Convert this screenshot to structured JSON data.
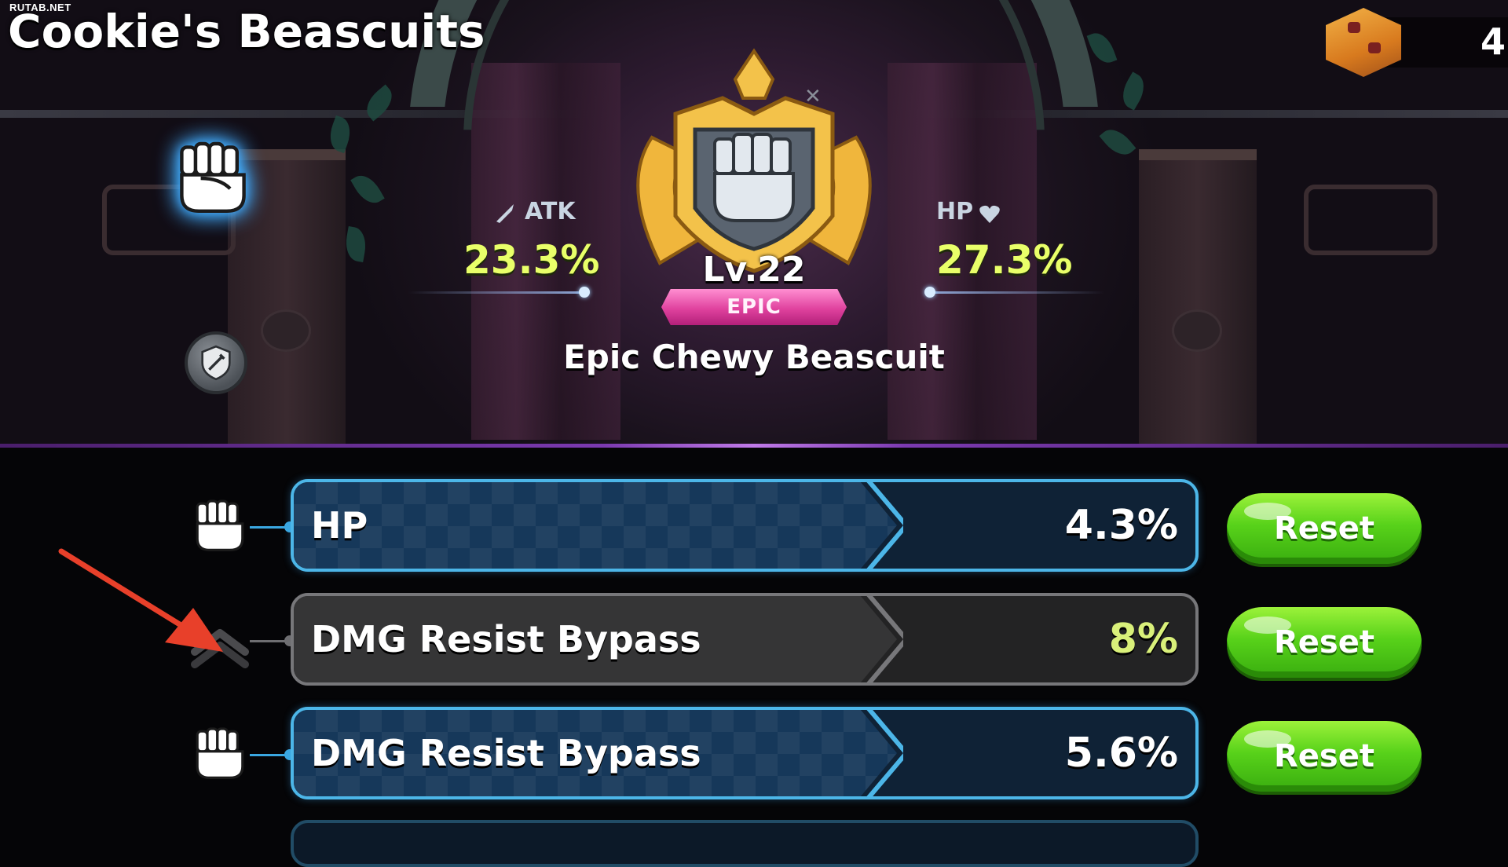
{
  "watermark": "RUTAB.NET",
  "header": {
    "title": "Cookie's Beascuits",
    "currency_value": "4"
  },
  "stats": {
    "atk_label": "ATK",
    "atk_value": "23.3%",
    "hp_label": "HP",
    "hp_value": "27.3%"
  },
  "beascuit": {
    "level": "Lv.22",
    "rarity": "EPIC",
    "name": "Epic Chewy Beascuit"
  },
  "rows": [
    {
      "label": "HP",
      "value": "4.3%",
      "state": "active",
      "icon": "fist-icon",
      "reset_label": "Reset"
    },
    {
      "label": "DMG Resist Bypass",
      "value": "8%",
      "state": "inactive",
      "icon": "chevron-up-icon",
      "reset_label": "Reset"
    },
    {
      "label": "DMG Resist Bypass",
      "value": "5.6%",
      "state": "active",
      "icon": "fist-icon",
      "reset_label": "Reset"
    }
  ],
  "colors": {
    "stat_value": "#e9ff69",
    "rarity_epic": "#e0429e",
    "bar_active_border": "#4cb6e8",
    "bar_inactive_border": "#77777a",
    "reset_button": "#58d21a",
    "annotation_arrow": "#e8402a"
  }
}
